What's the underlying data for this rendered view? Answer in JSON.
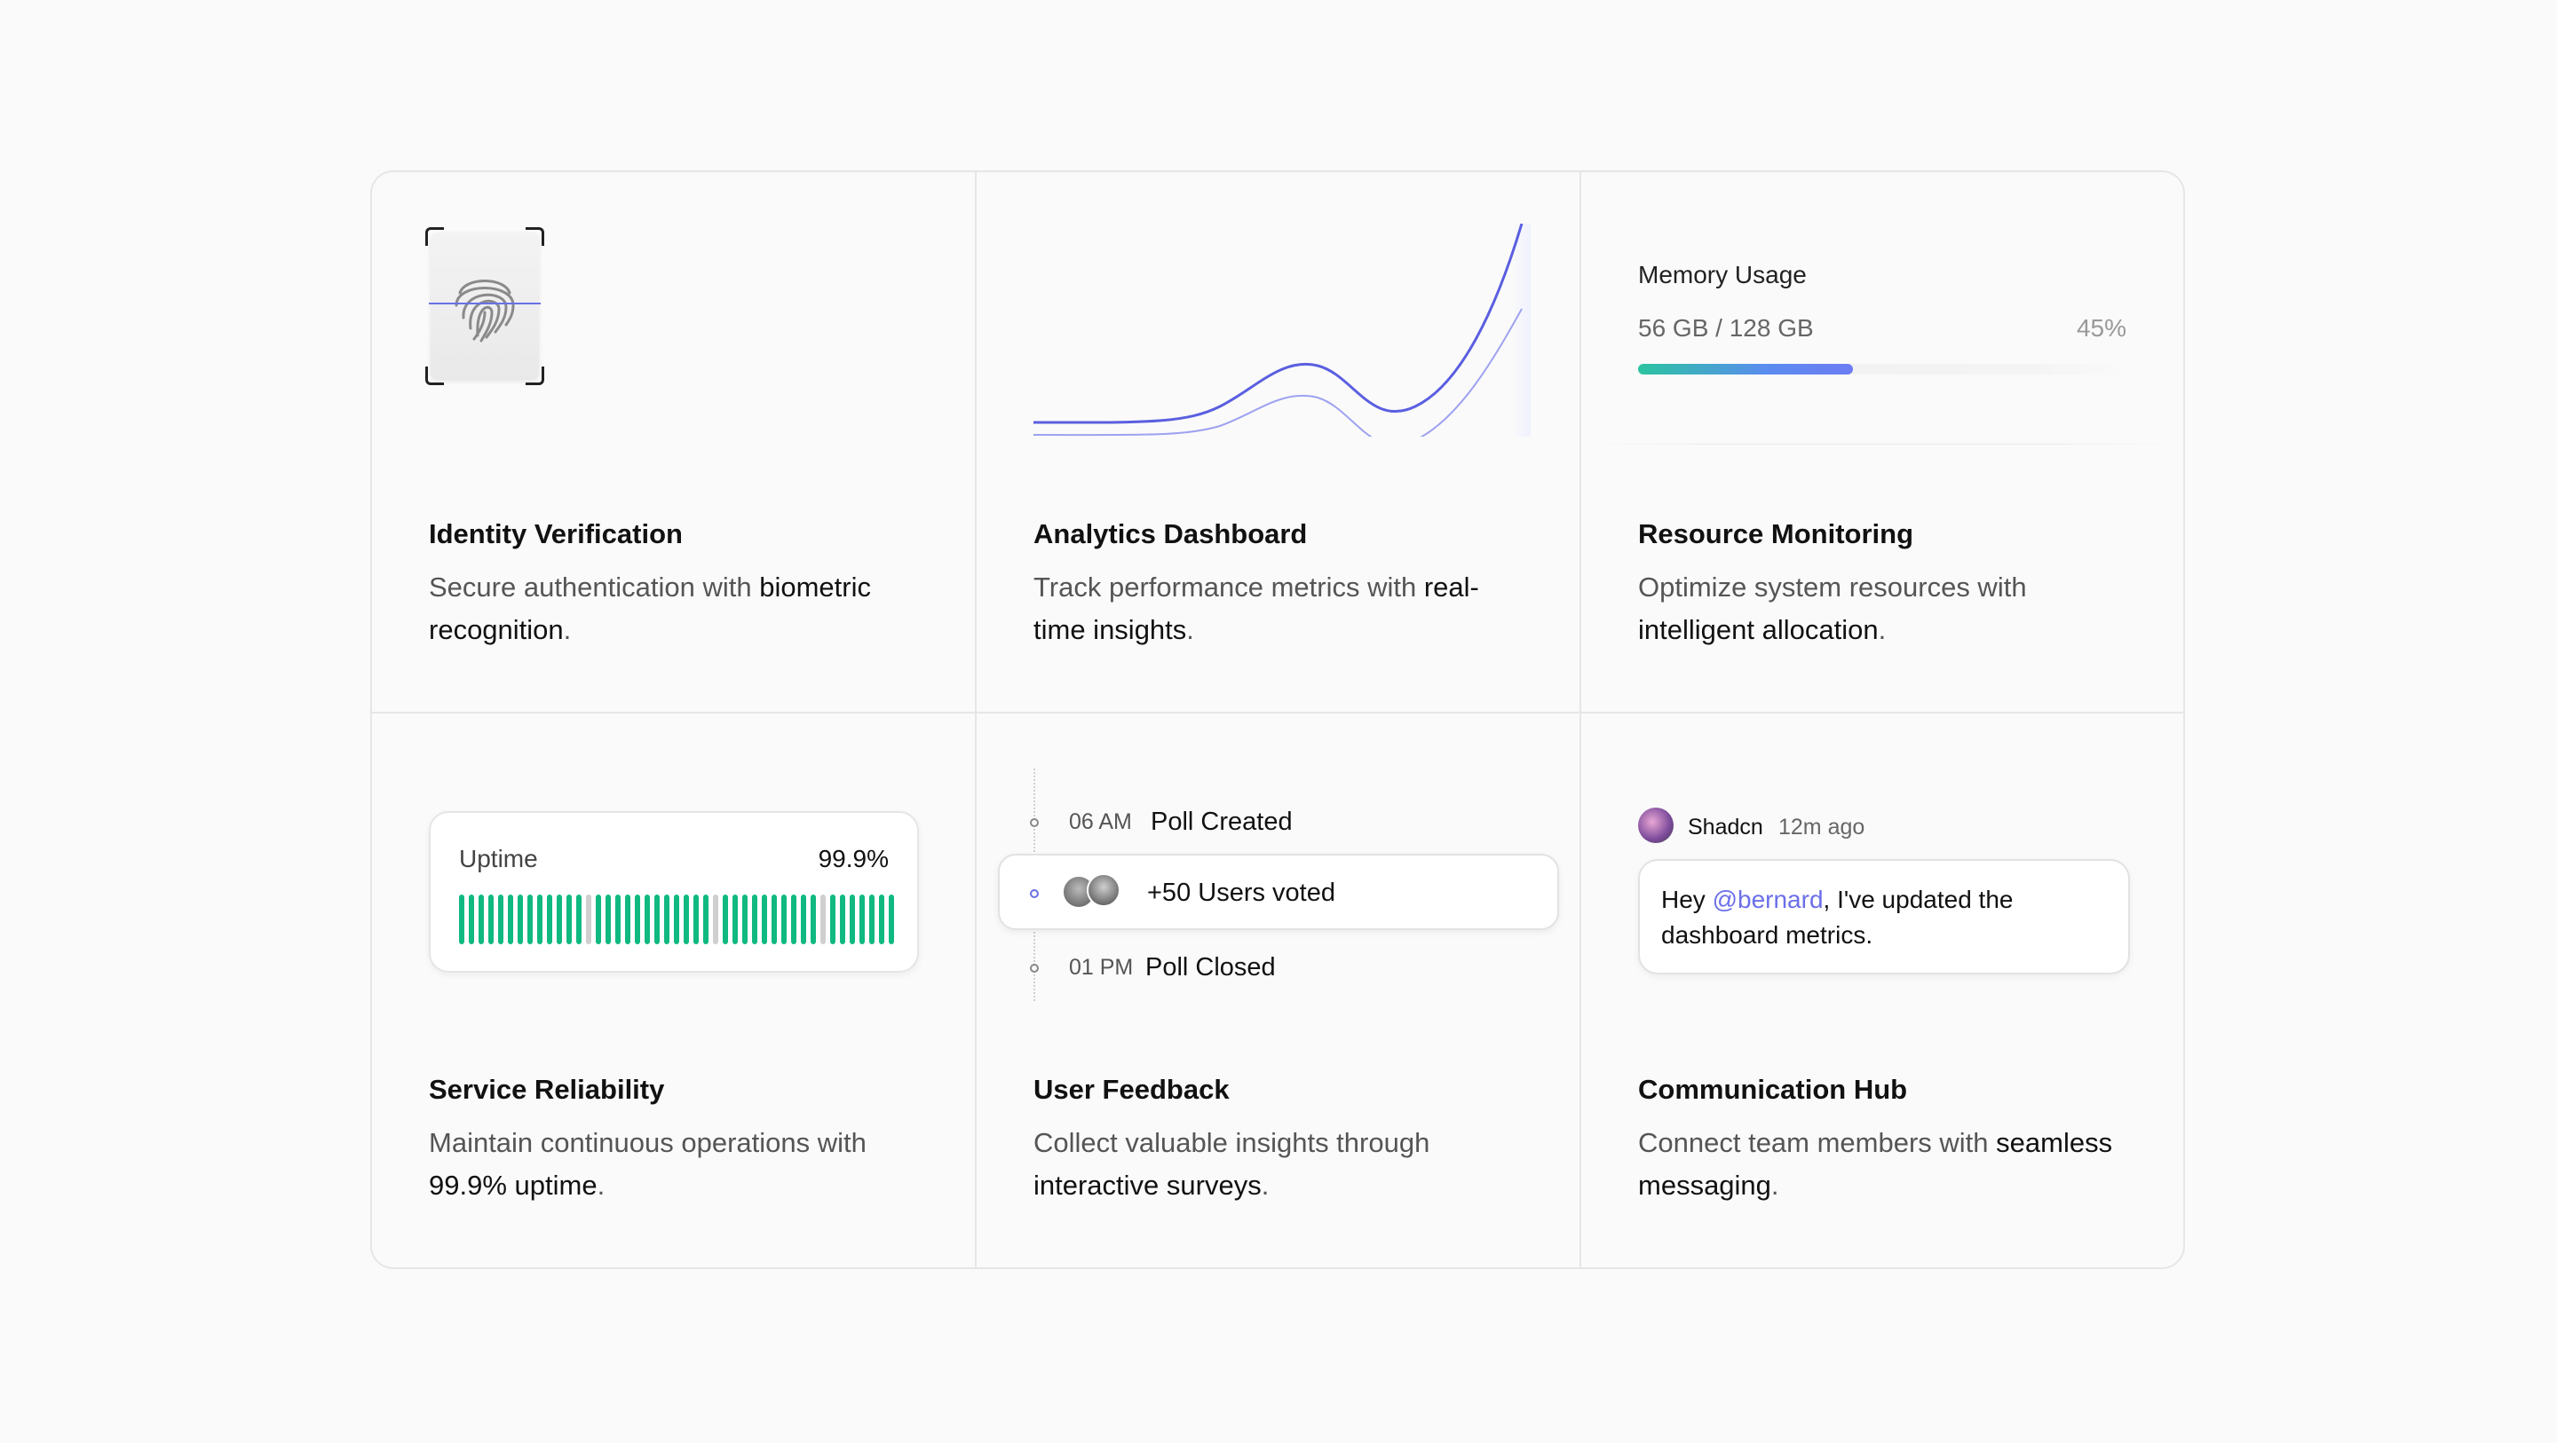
{
  "cards": [
    {
      "title": "Identity Verification",
      "desc_pre": "Secure authentication with ",
      "desc_bold": "biometric recognition",
      "desc_post": "."
    },
    {
      "title": "Analytics Dashboard",
      "desc_pre": "Track performance metrics with ",
      "desc_bold": "real-time insights",
      "desc_post": "."
    },
    {
      "title": "Resource Monitoring",
      "desc_pre": "Optimize system resources with ",
      "desc_bold": "intelligent allocation",
      "desc_post": "."
    },
    {
      "title": "Service Reliability",
      "desc_pre": "Maintain continuous operations with ",
      "desc_bold": "99.9% uptime",
      "desc_post": "."
    },
    {
      "title": "User Feedback",
      "desc_pre": "Collect valuable insights through ",
      "desc_bold": "interactive surveys",
      "desc_post": "."
    },
    {
      "title": "Communication Hub",
      "desc_pre": "Connect team members with ",
      "desc_bold": "seamless messaging",
      "desc_post": "."
    }
  ],
  "memory": {
    "label": "Memory Usage",
    "value": "56 GB / 128 GB",
    "percent_label": "45%",
    "fraction": 0.4375
  },
  "uptime": {
    "label": "Uptime",
    "value": "99.9%",
    "bars": [
      1,
      1,
      1,
      1,
      1,
      1,
      1,
      1,
      1,
      1,
      1,
      1,
      1,
      0,
      1,
      1,
      1,
      1,
      1,
      1,
      1,
      1,
      1,
      1,
      1,
      1,
      0,
      1,
      1,
      1,
      1,
      1,
      1,
      1,
      1,
      1,
      1,
      0,
      1,
      1,
      1,
      1,
      1,
      1,
      1
    ]
  },
  "poll": {
    "created_time": "06 AM",
    "created_text": "Poll Created",
    "voted_text": "+50 Users voted",
    "closed_time": "01 PM",
    "closed_text": "Poll Closed"
  },
  "chat": {
    "name": "Shadcn",
    "time": "12m ago",
    "msg_pre": "Hey ",
    "mention": "@bernard",
    "msg_post": ", I've updated the dashboard metrics."
  },
  "colors": {
    "accent": "#6b6fe8",
    "success": "#10b981",
    "muted_bar": "#cfcfcf"
  },
  "icons": {
    "identity": "fingerprint-icon"
  }
}
